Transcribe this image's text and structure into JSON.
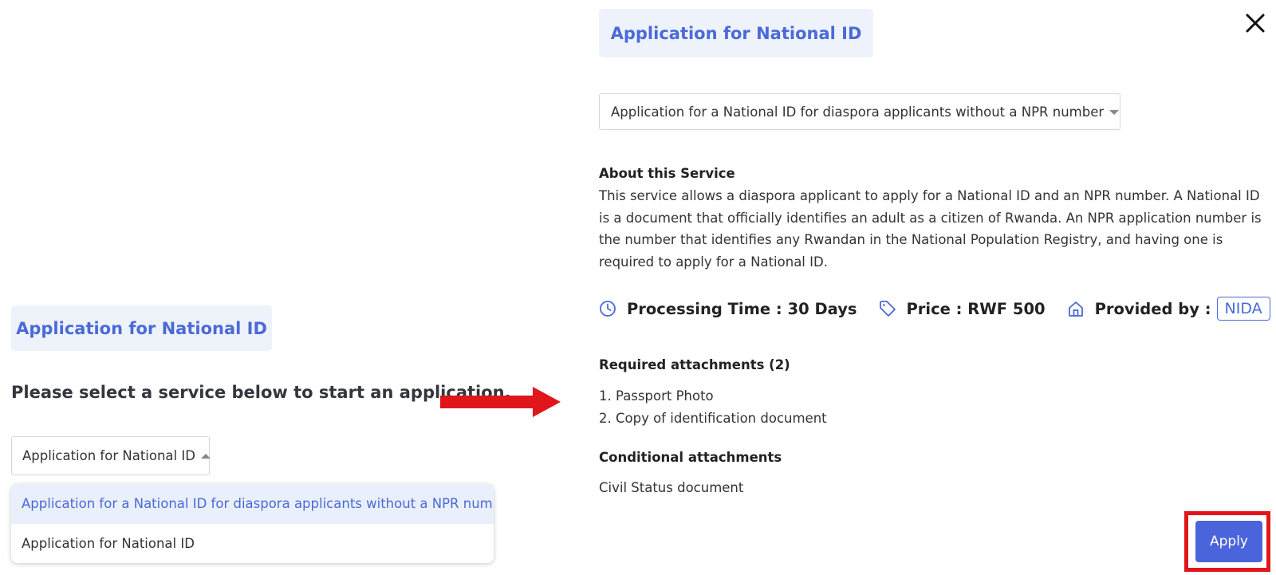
{
  "left_panel": {
    "title": "Application for National ID",
    "prompt": "Please select a service below to start an application.",
    "select": {
      "value": "Application for National ID"
    },
    "dropdown_options": [
      {
        "label": "Application for a National ID for diaspora applicants without a NPR number",
        "highlighted": true
      },
      {
        "label": "Application for National ID",
        "highlighted": false
      }
    ]
  },
  "right_panel": {
    "title": "Application for National ID",
    "select": {
      "value": "Application for a National ID for diaspora applicants without a NPR number"
    },
    "about": {
      "heading": "About this Service",
      "text": "This service allows a diaspora applicant to apply for a National ID and an NPR number. A National ID is a document that officially identifies an adult as a citizen of Rwanda. An NPR application number is the number that identifies any Rwandan in the National Population Registry, and having one is required to apply for a National ID."
    },
    "meta": {
      "processing_time": "Processing Time : 30 Days",
      "price": "Price : RWF 500",
      "provided_by_label": "Provided by :",
      "provider": "NIDA",
      "icons": [
        "clock-icon",
        "tag-icon",
        "home-icon"
      ]
    },
    "required_attachments": {
      "heading": "Required attachments (2)",
      "items": [
        "1. Passport Photo",
        "2. Copy of identification document"
      ]
    },
    "conditional_attachments": {
      "heading": "Conditional attachments",
      "items": [
        "Civil Status document"
      ]
    },
    "apply_label": "Apply",
    "close_icon": "close-icon"
  },
  "colors": {
    "accent": "#4a6ad8",
    "chip_bg": "#eef2fb",
    "highlight_bg": "#e9effb",
    "annotation_red": "#e0161b",
    "apply_bg": "#4a65db"
  }
}
